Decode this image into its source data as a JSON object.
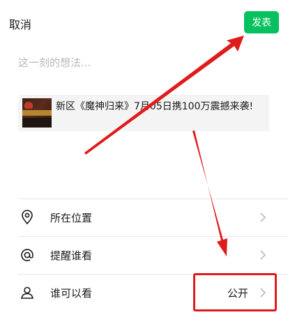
{
  "header": {
    "cancel_label": "取消",
    "publish_label": "发表"
  },
  "composer": {
    "placeholder": "这一刻的想法..."
  },
  "share_card": {
    "title": "新区《魔神归来》7月05日携100万震撼来袭!"
  },
  "settings": [
    {
      "label": "所在位置",
      "icon": "location-pin-icon",
      "value": ""
    },
    {
      "label": "提醒谁看",
      "icon": "at-icon",
      "value": ""
    },
    {
      "label": "谁可以看",
      "icon": "person-icon",
      "value": "公开"
    }
  ],
  "colors": {
    "accent": "#07C160",
    "annotation": "#E01B1B"
  }
}
